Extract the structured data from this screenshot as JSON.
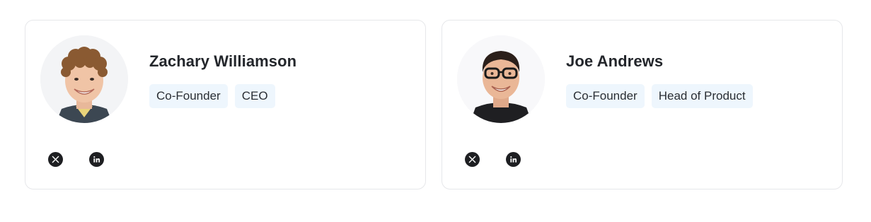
{
  "members": [
    {
      "name": "Zachary Williamson",
      "tags": [
        "Co-Founder",
        "CEO"
      ],
      "socials": [
        {
          "icon": "x-twitter-icon"
        },
        {
          "icon": "linkedin-icon"
        }
      ]
    },
    {
      "name": "Joe Andrews",
      "tags": [
        "Co-Founder",
        "Head of Product"
      ],
      "socials": [
        {
          "icon": "x-twitter-icon"
        },
        {
          "icon": "linkedin-icon"
        }
      ]
    }
  ],
  "colors": {
    "card_border": "#e6e7ea",
    "tag_background": "#eef6fd",
    "text": "#23262b",
    "icon_circle": "#1e1f22"
  }
}
